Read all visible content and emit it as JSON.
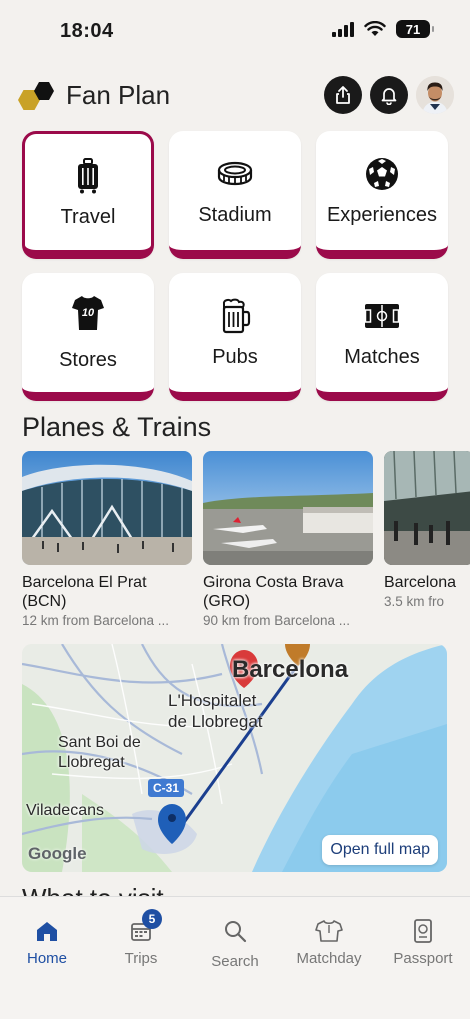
{
  "status": {
    "time": "18:04",
    "battery": "71"
  },
  "header": {
    "brand": "Fan Plan",
    "share_icon": "share-icon",
    "bell_icon": "bell-icon"
  },
  "tiles": [
    {
      "label": "Travel",
      "icon": "luggage-icon",
      "active": true
    },
    {
      "label": "Stadium",
      "icon": "stadium-icon"
    },
    {
      "label": "Experiences",
      "icon": "soccer-ball-icon"
    },
    {
      "label": "Stores",
      "icon": "jersey-icon"
    },
    {
      "label": "Pubs",
      "icon": "beer-mug-icon"
    },
    {
      "label": "Matches",
      "icon": "pitch-icon"
    }
  ],
  "section": {
    "title": "Planes & Trains"
  },
  "places": [
    {
      "name": "Barcelona El Prat\n(BCN)",
      "distance": "12 km from Barcelona ..."
    },
    {
      "name": "Girona Costa Brava\n(GRO)",
      "distance": "90 km from Barcelona ..."
    },
    {
      "name": "Barcelona",
      "distance": "3.5 km fro"
    }
  ],
  "map": {
    "labels": {
      "city": "Barcelona",
      "hospitalet": "L'Hospitalet\nde Llobregat",
      "santboi": "Sant Boi de\nLlobregat",
      "viladecans": "Viladecans",
      "road": "C-31",
      "google": "Google"
    },
    "open_full_map": "Open full map"
  },
  "bottom_peek": "What to visit",
  "nav": {
    "items": [
      {
        "label": "Home",
        "icon": "home-icon",
        "active": true
      },
      {
        "label": "Trips",
        "icon": "calendar-icon",
        "badge": "5"
      },
      {
        "label": "Search",
        "icon": "search-icon"
      },
      {
        "label": "Matchday",
        "icon": "shirt-icon"
      },
      {
        "label": "Passport",
        "icon": "passport-icon"
      }
    ]
  }
}
